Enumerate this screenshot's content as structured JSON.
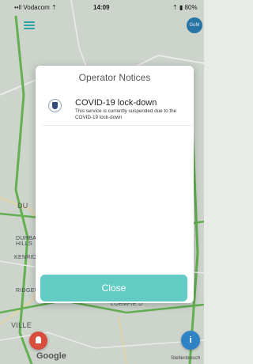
{
  "status_bar": {
    "carrier": "••ll Vodacom ⇡",
    "time": "14:09",
    "battery": "⇡ ▮ 80%"
  },
  "map": {
    "labels": {
      "du": "DU",
      "durbanville_hills": "DURBANV. HILLS",
      "kenridge": "KENRIDGE",
      "ridgeworth": "RIDGEW.",
      "ville": "VILLE",
      "bottom_road": "LOEMFIE.D"
    },
    "corner_logo": "GoM",
    "town": "Stellenbosch",
    "google": "Google"
  },
  "modal": {
    "title": "Operator Notices",
    "notice": {
      "icon": "shield-crest-icon",
      "title": "COVID-19 lock-down",
      "body": "This service is currently suspended due to the COVID-19 lock-down"
    },
    "close_label": "Close"
  },
  "buttons": {
    "info_label": "i"
  },
  "colors": {
    "accent": "#62ccc4",
    "sos": "#d94d3d",
    "info": "#2f83c5"
  }
}
